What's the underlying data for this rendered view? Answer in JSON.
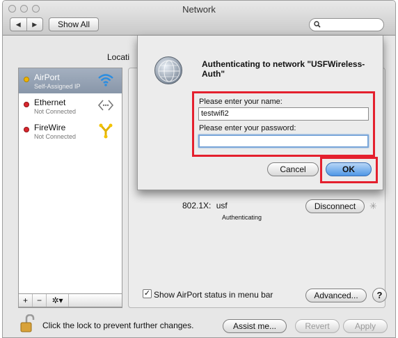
{
  "window": {
    "title": "Network",
    "nav_back": "◀",
    "nav_forward": "▶",
    "show_all": "Show All",
    "search_placeholder": "",
    "search_icon": "magnifier-icon"
  },
  "location": {
    "label": "Locati"
  },
  "sidebar": {
    "items": [
      {
        "name": "AirPort",
        "status": "Self-Assigned IP",
        "status_color": "#f0b400",
        "icon": "wifi-icon",
        "selected": true
      },
      {
        "name": "Ethernet",
        "status": "Not Connected",
        "status_color": "#d9262d",
        "icon": "ethernet-icon",
        "selected": false
      },
      {
        "name": "FireWire",
        "status": "Not Connected",
        "status_color": "#d9262d",
        "icon": "firewire-icon",
        "selected": false
      }
    ],
    "add": "+",
    "remove": "−",
    "gear": "✲▾"
  },
  "detail": {
    "label_8021x": "802.1X:",
    "value_8021x": "usf",
    "status_8021x": "Authenticating",
    "disconnect": "Disconnect",
    "show_status_label": "Show AirPort status in menu bar",
    "show_status_checked": true,
    "advanced": "Advanced...",
    "help": "?"
  },
  "footer": {
    "lock_text": "Click the lock to prevent further changes.",
    "assist": "Assist me...",
    "revert": "Revert",
    "apply": "Apply"
  },
  "dialog": {
    "title": "Authenticating to network \"USFWireless-Auth\"",
    "name_label": "Please enter your name:",
    "name_value": "testwifi2",
    "password_label": "Please enter your password:",
    "password_value": "",
    "cancel": "Cancel",
    "ok": "OK"
  },
  "colors": {
    "highlight_box": "#e4202e",
    "accent": "#4f97e6"
  }
}
